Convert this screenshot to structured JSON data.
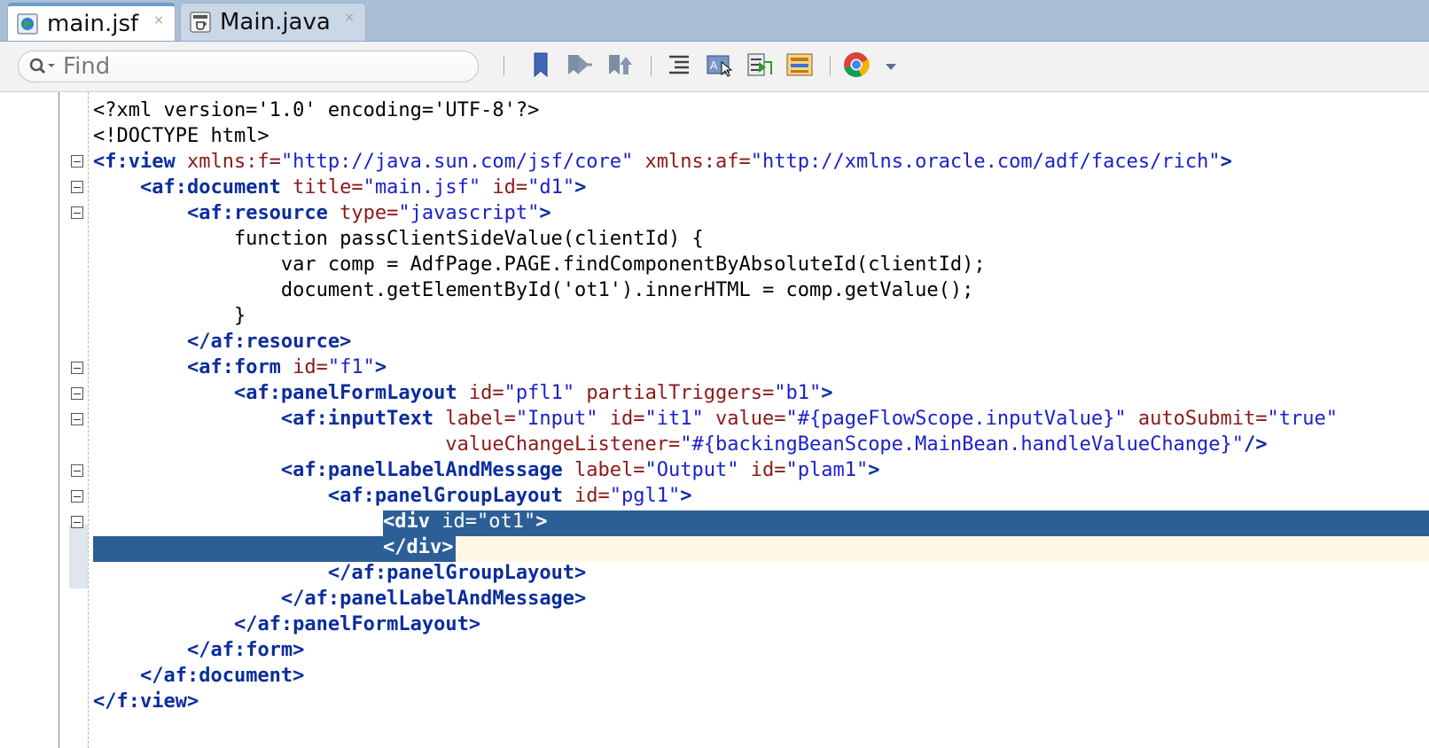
{
  "tabs": [
    {
      "label": "main.jsf",
      "active": true,
      "icon": "jsf-globe-icon"
    },
    {
      "label": "Main.java",
      "active": false,
      "icon": "java-file-icon"
    }
  ],
  "tab_close_glyph": "×",
  "toolbar": {
    "find_placeholder": "Find",
    "buttons": [
      "toggle-bookmark-icon",
      "previous-bookmark-icon",
      "next-bookmark-icon",
      "shift-line-icon",
      "toggle-design-icon",
      "start-macro-icon",
      "show-structure-icon",
      "chrome-browser-icon",
      "dropdown-arrow-icon"
    ]
  },
  "code": {
    "l1": "<?xml version='1.0' encoding='UTF-8'?>",
    "l2": "<!DOCTYPE html>",
    "l3": {
      "open": "<f:view",
      "a1": " xmlns:f=",
      "v1": "\"http://java.sun.com/jsf/core\"",
      "a2": " xmlns:af=",
      "v2": "\"http://xmlns.oracle.com/adf/faces/rich\"",
      "close": ">"
    },
    "l4": {
      "indent": "    ",
      "open": "<af:document",
      "a1": " title=",
      "v1": "\"main.jsf\"",
      "a2": " id=",
      "v2": "\"d1\"",
      "close": ">"
    },
    "l5": {
      "indent": "        ",
      "open": "<af:resource",
      "a1": " type=",
      "v1": "\"javascript\"",
      "close": ">"
    },
    "l6": "            function passClientSideValue(clientId) {",
    "l7": "                var comp = AdfPage.PAGE.findComponentByAbsoluteId(clientId);",
    "l8": "                document.getElementById('ot1').innerHTML = comp.getValue();",
    "l9": "            }",
    "l10": {
      "indent": "        ",
      "tag": "</af:resource>"
    },
    "l11": {
      "indent": "        ",
      "open": "<af:form",
      "a1": " id=",
      "v1": "\"f1\"",
      "close": ">"
    },
    "l12": {
      "indent": "            ",
      "open": "<af:panelFormLayout",
      "a1": " id=",
      "v1": "\"pfl1\"",
      "a2": " partialTriggers=",
      "v2": "\"b1\"",
      "close": ">"
    },
    "l13": {
      "indent": "                ",
      "open": "<af:inputText",
      "a1": " label=",
      "v1": "\"Input\"",
      "a2": " id=",
      "v2": "\"it1\"",
      "a3": " value=",
      "v3": "\"#{pageFlowScope.inputValue}\"",
      "a4": " autoSubmit=",
      "v4": "\"true\""
    },
    "l14": {
      "indent": "                              ",
      "a1": "valueChangeListener=",
      "v1": "\"#{backingBeanScope.MainBean.handleValueChange}\"",
      "close": "/>"
    },
    "l15": {
      "indent": "                ",
      "open": "<af:panelLabelAndMessage",
      "a1": " label=",
      "v1": "\"Output\"",
      "a2": " id=",
      "v2": "\"plam1\"",
      "close": ">"
    },
    "l16": {
      "indent": "                    ",
      "open": "<af:panelGroupLayout",
      "a1": " id=",
      "v1": "\"pgl1\"",
      "close": ">"
    },
    "l17": {
      "open": "<div",
      "a1": " id=",
      "v1": "\"ot1\"",
      "close": ">"
    },
    "l18": {
      "tag": "</div>"
    },
    "l19": {
      "indent": "                    ",
      "tag": "</af:panelGroupLayout>"
    },
    "l20": {
      "indent": "                ",
      "tag": "</af:panelLabelAndMessage>"
    },
    "l21": {
      "indent": "            ",
      "tag": "</af:panelFormLayout>"
    },
    "l22": {
      "indent": "        ",
      "tag": "</af:form>"
    },
    "l23": {
      "indent": "    ",
      "tag": "</af:document>"
    },
    "l24": {
      "tag": "</f:view>"
    }
  }
}
